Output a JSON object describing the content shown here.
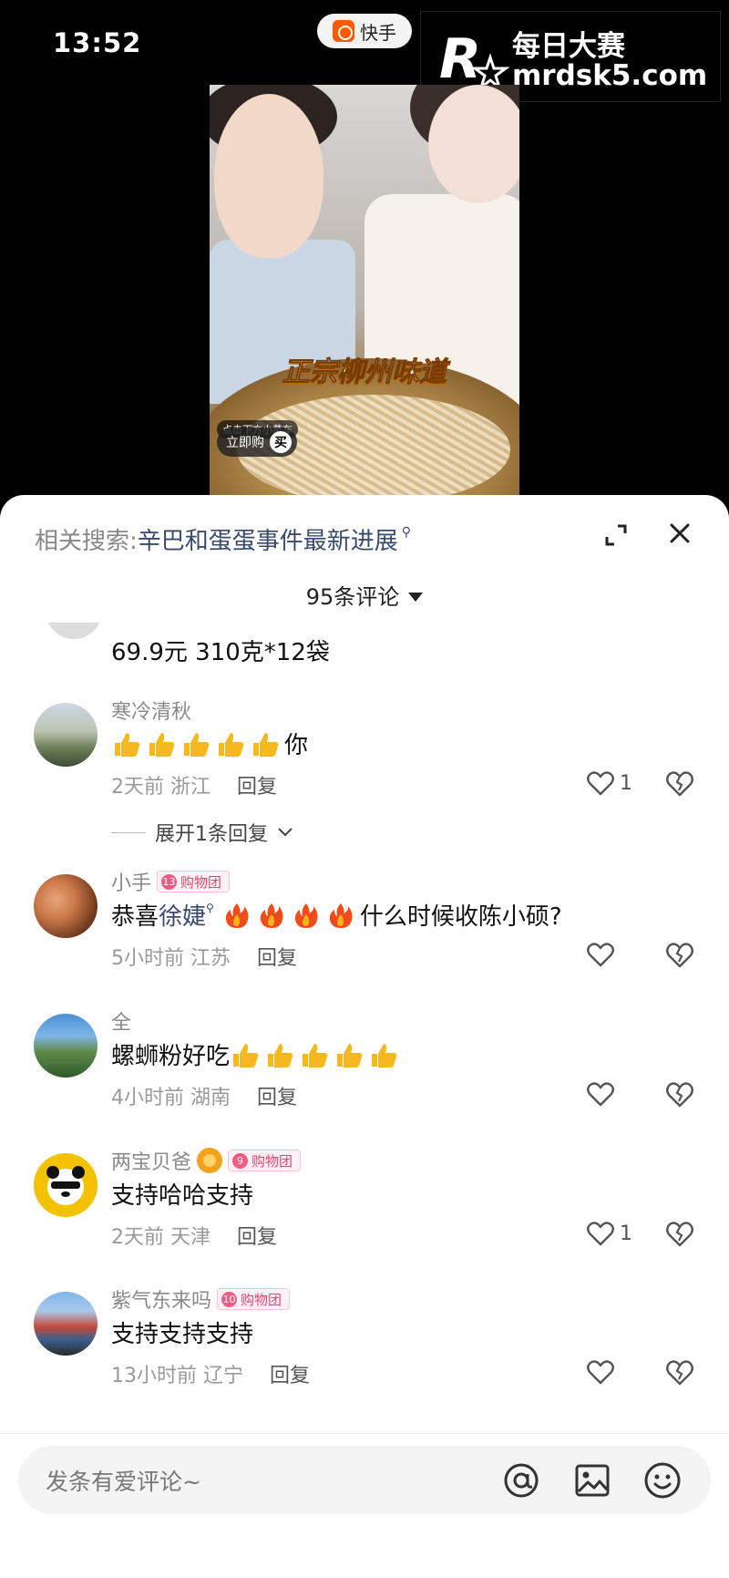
{
  "status_bar": {
    "time": "13:52"
  },
  "app_pill": {
    "label": "快手"
  },
  "watermark": {
    "title": "每日大赛",
    "url": "mrdsk5.com",
    "logo_letter": "R"
  },
  "video": {
    "banner_text": "正宗柳州味道",
    "buy_hint": "点击下方小黄车",
    "buy_label": "立即购",
    "buy_char": "买"
  },
  "sheet": {
    "related_label": "相关搜索:",
    "related_keyword": "辛巴和蛋蛋事件最新进展",
    "comment_count_label": "95条评论"
  },
  "comments": {
    "partial": {
      "text": "69.9元 310克*12袋"
    },
    "items": [
      {
        "username": "寒冷清秋",
        "text_suffix": "你",
        "time": "2天前",
        "location": "浙江",
        "reply_label": "回复",
        "like_count": "1",
        "expand_label": "展开1条回复"
      },
      {
        "username": "小手",
        "badge_level": "13",
        "badge_label": "购物团",
        "text_prefix": "恭喜",
        "text_link": "徐婕",
        "text_suffix": "什么时候收陈小硕?",
        "time": "5小时前",
        "location": "江苏",
        "reply_label": "回复"
      },
      {
        "username": "全",
        "text_prefix": "螺蛳粉好吃",
        "time": "4小时前",
        "location": "湖南",
        "reply_label": "回复"
      },
      {
        "username": "两宝贝爸",
        "badge_level": "9",
        "badge_label": "购物团",
        "text": "支持哈哈支持",
        "time": "2天前",
        "location": "天津",
        "reply_label": "回复",
        "like_count": "1"
      },
      {
        "username": "紫气东来吗",
        "badge_level": "10",
        "badge_label": "购物团",
        "text": "支持支持支持",
        "time": "13小时前",
        "location": "辽宁",
        "reply_label": "回复"
      }
    ]
  },
  "input": {
    "placeholder": "发条有爱评论~"
  },
  "icons": {
    "thumb": "thumbs-up-emoji",
    "fire": "fire-emoji",
    "like": "heart-outline-icon",
    "dislike": "broken-heart-icon"
  },
  "colors": {
    "link": "#3a4a6e",
    "badge": "#e8456e",
    "brand": "#ff5a00"
  }
}
